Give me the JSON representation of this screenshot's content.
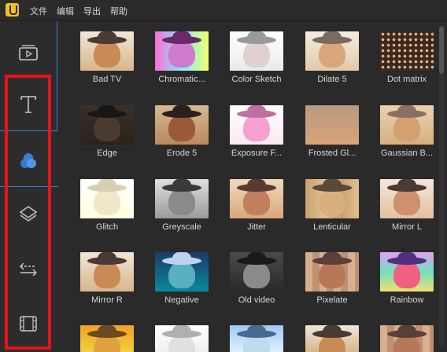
{
  "menu": [
    "文件",
    "编辑",
    "导出",
    "帮助"
  ],
  "sidebar": {
    "items": [
      {
        "name": "media",
        "icon": "video-icon"
      },
      {
        "name": "text",
        "icon": "text-icon"
      },
      {
        "name": "filters",
        "icon": "filters-icon",
        "active": true
      },
      {
        "name": "overlays",
        "icon": "layers-icon"
      },
      {
        "name": "transitions",
        "icon": "transition-icon"
      },
      {
        "name": "elements",
        "icon": "film-icon"
      }
    ],
    "highlight_color": "#e6121a",
    "accent": "#3a7fd6"
  },
  "filters": [
    {
      "label": "Bad TV",
      "style": "normal"
    },
    {
      "label": "Chromatic...",
      "style": "chromatic"
    },
    {
      "label": "Color Sketch",
      "style": "sketch"
    },
    {
      "label": "Dilate 5",
      "style": "dilate"
    },
    {
      "label": "Dot matrix",
      "style": "dots"
    },
    {
      "label": "Edge",
      "style": "edge"
    },
    {
      "label": "Erode 5",
      "style": "erode"
    },
    {
      "label": "Exposure F...",
      "style": "exposure"
    },
    {
      "label": "Frosted Gl...",
      "style": "frosted"
    },
    {
      "label": "Gaussian B...",
      "style": "gaussian"
    },
    {
      "label": "Glitch",
      "style": "glitch"
    },
    {
      "label": "Greyscale",
      "style": "grey"
    },
    {
      "label": "Jitter",
      "style": "jitter"
    },
    {
      "label": "Lenticular",
      "style": "lenticular"
    },
    {
      "label": "Mirror L",
      "style": "mirror"
    },
    {
      "label": "Mirror R",
      "style": "normal"
    },
    {
      "label": "Negative",
      "style": "negative"
    },
    {
      "label": "Old video",
      "style": "old"
    },
    {
      "label": "Pixelate",
      "style": "pixel"
    },
    {
      "label": "Rainbow",
      "style": "rainbow"
    },
    {
      "label": "",
      "style": "yellow"
    },
    {
      "label": "",
      "style": "light"
    },
    {
      "label": "",
      "style": "blue"
    },
    {
      "label": "",
      "style": "normal"
    },
    {
      "label": "",
      "style": "pixel"
    }
  ]
}
